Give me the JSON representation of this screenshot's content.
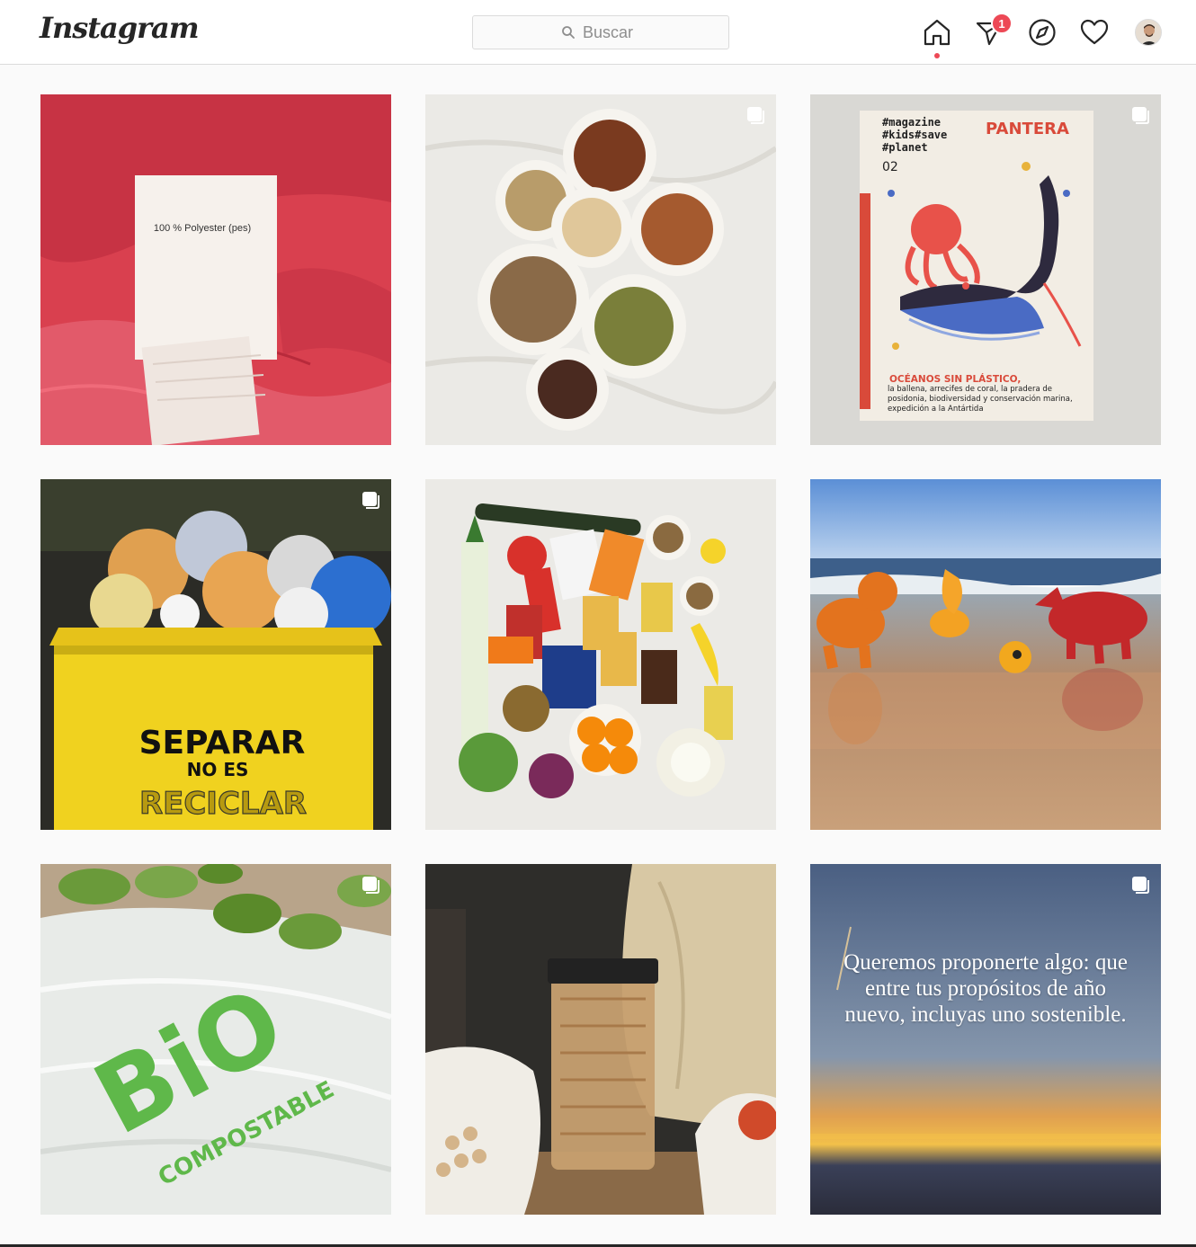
{
  "header": {
    "logo": "Instagram",
    "search_placeholder": "Buscar",
    "notifications_count": "1",
    "icons": [
      "home-icon",
      "direct-icon",
      "compass-icon",
      "heart-icon",
      "avatar"
    ],
    "accent_color": "#ed4956"
  },
  "posts": [
    {
      "label": "100 % Polyester (pes)",
      "multi": false
    },
    {
      "multi": true
    },
    {
      "magazine_tags": [
        "#magazine",
        "#kids#save",
        "#planet"
      ],
      "magazine_number": "02",
      "magazine_title": "PANTERA",
      "magazine_subtitle": "OCÉANOS SIN PLÁSTICO,",
      "magazine_body": "la ballena, arrecifes de coral, la pradera de posidonia, biodiversidad y conservación marina, expedición a la Antártida",
      "multi": true
    },
    {
      "line1": "SEPARAR",
      "line2": "NO ES",
      "line3": "RECICLAR",
      "multi": true
    },
    {
      "multi": false
    },
    {
      "multi": false
    },
    {
      "bag_line1": "BiO",
      "bag_line2": "COMPOSTABLE",
      "multi": true
    },
    {
      "multi": false
    },
    {
      "quote": "Queremos proponerte algo: que entre tus propósitos de año nuevo, incluyas uno sostenible.",
      "multi": true
    }
  ]
}
